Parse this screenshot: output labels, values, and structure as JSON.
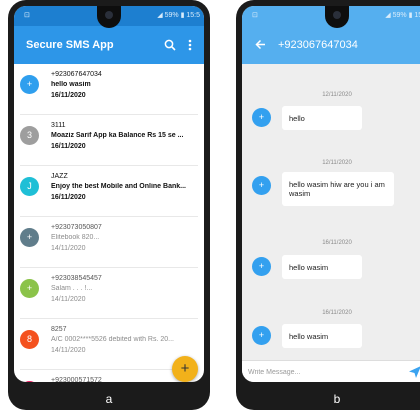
{
  "colors": {
    "primary": "#2d96e8",
    "chat_header": "#55afef",
    "fab": "#f2b11a",
    "chat_background": "#eeeeee"
  },
  "captions": {
    "a": "a",
    "b": "b"
  },
  "phone_a": {
    "status": {
      "left": "⊡",
      "right": "◢ 59% ▮ 15:5"
    },
    "app_title": "Secure SMS App",
    "search_icon": "search-icon",
    "menu_icon": "more-vert-icon",
    "fab_label": "+",
    "conversations": [
      {
        "avatar": "+",
        "avatar_color": "#2f9fee",
        "address": "+923067647034",
        "preview": "hello wasim",
        "date": "16/11/2020",
        "unread": true
      },
      {
        "avatar": "3",
        "avatar_color": "#9e9e9e",
        "address": "3111",
        "preview": "Moaziz Sarif App ka Balance Rs 15 se ...",
        "date": "16/11/2020",
        "unread": true
      },
      {
        "avatar": "J",
        "avatar_color": "#1fbfd6",
        "address": "JAZZ",
        "preview": "Enjoy the best Mobile and Online Bank...",
        "date": "16/11/2020",
        "unread": true
      },
      {
        "avatar": "+",
        "avatar_color": "#607d8b",
        "address": "+923073050807",
        "preview": "Elitebook 820...",
        "date": "14/11/2020",
        "unread": false
      },
      {
        "avatar": "+",
        "avatar_color": "#8bc34a",
        "address": "+923038545457",
        "preview": "Salam . . . !...",
        "date": "14/11/2020",
        "unread": false
      },
      {
        "avatar": "8",
        "avatar_color": "#f4511e",
        "address": "8257",
        "preview": "A/C 0002****5526 debited with Rs. 20...",
        "date": "14/11/2020",
        "unread": false
      },
      {
        "avatar": "+",
        "avatar_color": "#e91e63",
        "address": "+923000571572",
        "preview": "",
        "date": "",
        "unread": false
      }
    ]
  },
  "phone_b": {
    "status": {
      "left": "⊡",
      "right": "◢ 59% ▮ 15:5"
    },
    "back_icon": "back-arrow-icon",
    "contact": "+923067647034",
    "messages": [
      {
        "date": "12/11/2020",
        "avatar": "+",
        "text": "hello"
      },
      {
        "date": "12/11/2020",
        "avatar": "+",
        "text": "hello wasim hiw are you i am wasim"
      },
      {
        "date": "16/11/2020",
        "avatar": "+",
        "text": "hello wasim"
      },
      {
        "date": "16/11/2020",
        "avatar": "+",
        "text": "hello wasim"
      }
    ],
    "composer_placeholder": "Write Message...",
    "send_icon": "send-icon"
  }
}
